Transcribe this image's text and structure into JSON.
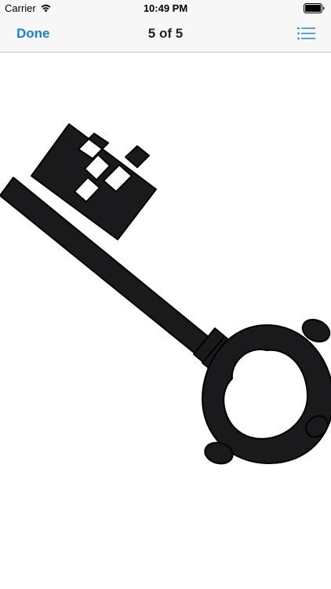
{
  "status_bar": {
    "carrier": "Carrier",
    "time": "10:49 PM",
    "wifi_icon": "wifi-icon",
    "battery_icon": "battery-icon"
  },
  "nav_bar": {
    "done_label": "Done",
    "title": "5 of 5",
    "list_icon": "list-icon",
    "accent_color": "#1a7fd1"
  },
  "content": {
    "image_icon": "skeleton-key-icon",
    "key_fill_color": "#1a1a1c"
  }
}
